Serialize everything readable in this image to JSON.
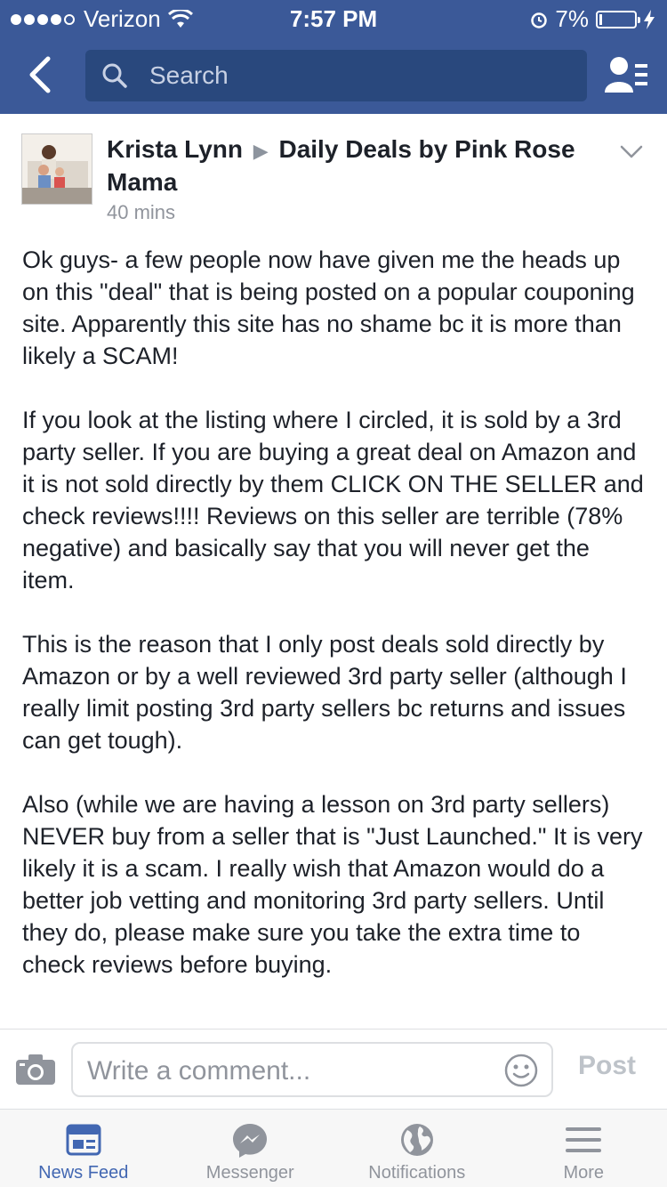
{
  "status_bar": {
    "carrier": "Verizon",
    "time": "7:57 PM",
    "battery_text": "7%",
    "battery_level": 0.07
  },
  "search": {
    "placeholder": "Search"
  },
  "post": {
    "author": "Krista Lynn",
    "group": "Daily Deals by Pink Rose Mama",
    "timestamp": "40 mins",
    "paragraphs": [
      "Ok guys- a few people now have given me the heads up on this \"deal\" that is being posted on a popular couponing site.  Apparently this site has no shame bc it is more than likely a SCAM!",
      "If you look at the listing where I circled, it is sold by a 3rd party seller.  If you are buying a great deal on Amazon and it is not sold directly by them CLICK ON THE SELLER and check reviews!!!! Reviews on this seller are terrible (78% negative) and basically say that you will never get the item.",
      "This is the reason that I only post deals sold directly by Amazon or by a well reviewed 3rd party seller (although I really limit posting 3rd party sellers bc returns and issues can get tough).",
      "Also (while we are having a lesson on 3rd party sellers) NEVER buy from a seller that is \"Just Launched.\"  It is very likely it is a scam.  I really wish that Amazon would do a better job vetting and monitoring 3rd party sellers.  Until they do, please make sure you take the extra time to check reviews before buying."
    ]
  },
  "comment": {
    "placeholder": "Write a comment...",
    "post_label": "Post"
  },
  "tabs": [
    {
      "label": "News Feed",
      "icon": "news-feed-icon",
      "active": true
    },
    {
      "label": "Messenger",
      "icon": "messenger-icon",
      "active": false
    },
    {
      "label": "Notifications",
      "icon": "globe-icon",
      "active": false
    },
    {
      "label": "More",
      "icon": "menu-icon",
      "active": false
    }
  ],
  "colors": {
    "brand": "#3b5998",
    "active_tab": "#4267b2",
    "inactive": "#90949c"
  }
}
